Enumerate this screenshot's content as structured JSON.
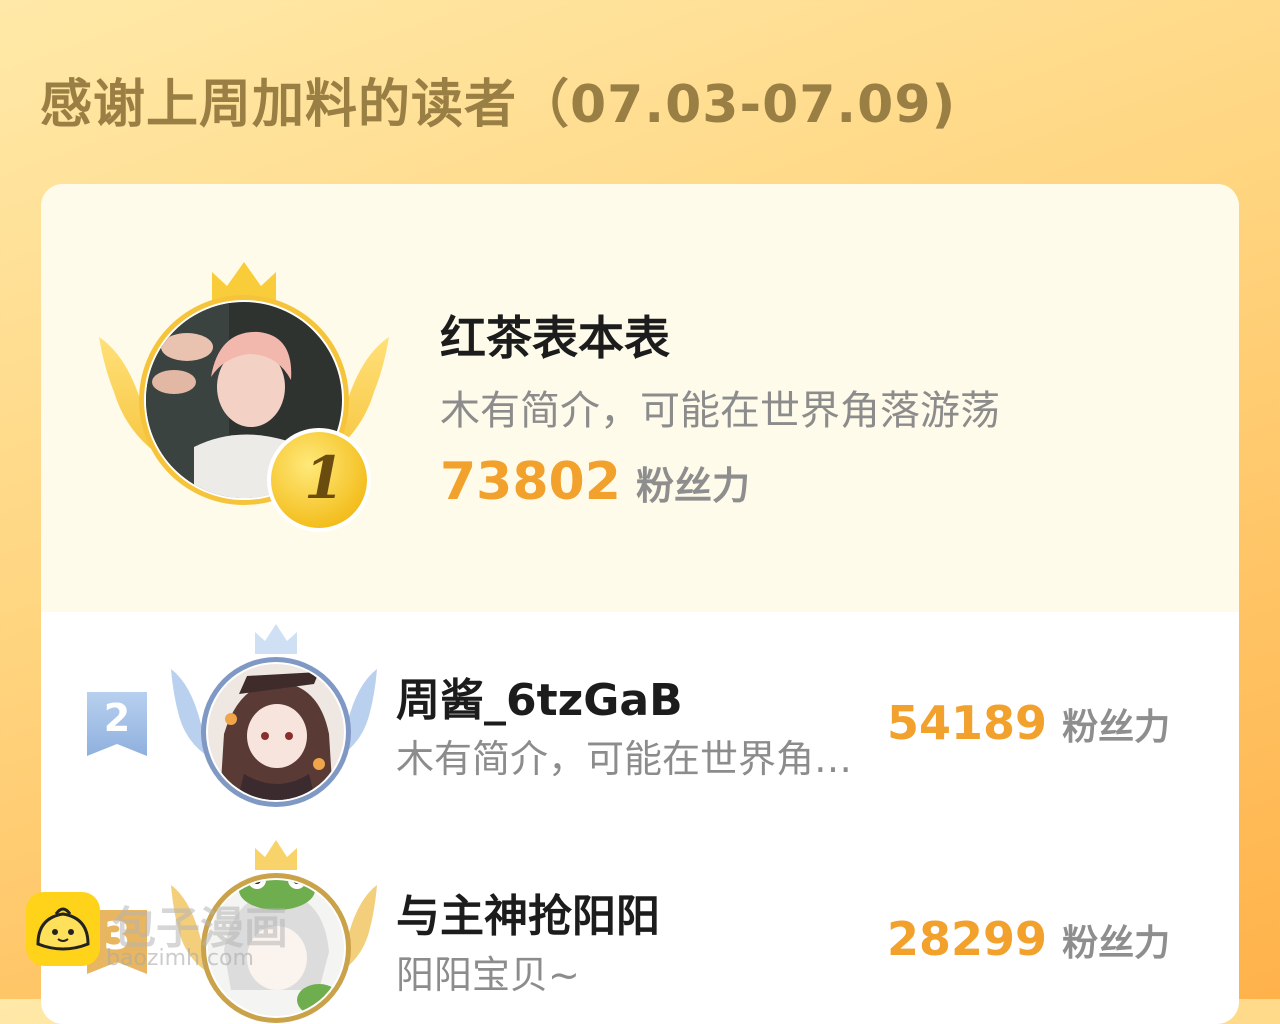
{
  "header": {
    "title": "感谢上周加料的读者（07.03-07.09)"
  },
  "ranking": {
    "first": {
      "rank": "1",
      "name": "红茶表本表",
      "bio": "木有简介，可能在世界角落游荡",
      "score": "73802",
      "unit": "粉丝力"
    },
    "rows": [
      {
        "rank": "2",
        "name": "周酱_6tzGaB",
        "bio": "木有简介，可能在世界角…",
        "score": "54189",
        "unit": "粉丝力"
      },
      {
        "rank": "3",
        "name": "与主神抢阳阳",
        "bio": "阳阳宝贝~",
        "score": "28299",
        "unit": "粉丝力"
      }
    ]
  },
  "watermark": {
    "text": "包子漫画",
    "url": "baozimh.com"
  },
  "colors": {
    "background_top": "#ffe9a8",
    "background_bottom": "#ffb24a",
    "title": "#9a7f45",
    "score": "#f1a12c",
    "gold": "#f5c32c",
    "silver_blue": "#a8c4e8"
  }
}
